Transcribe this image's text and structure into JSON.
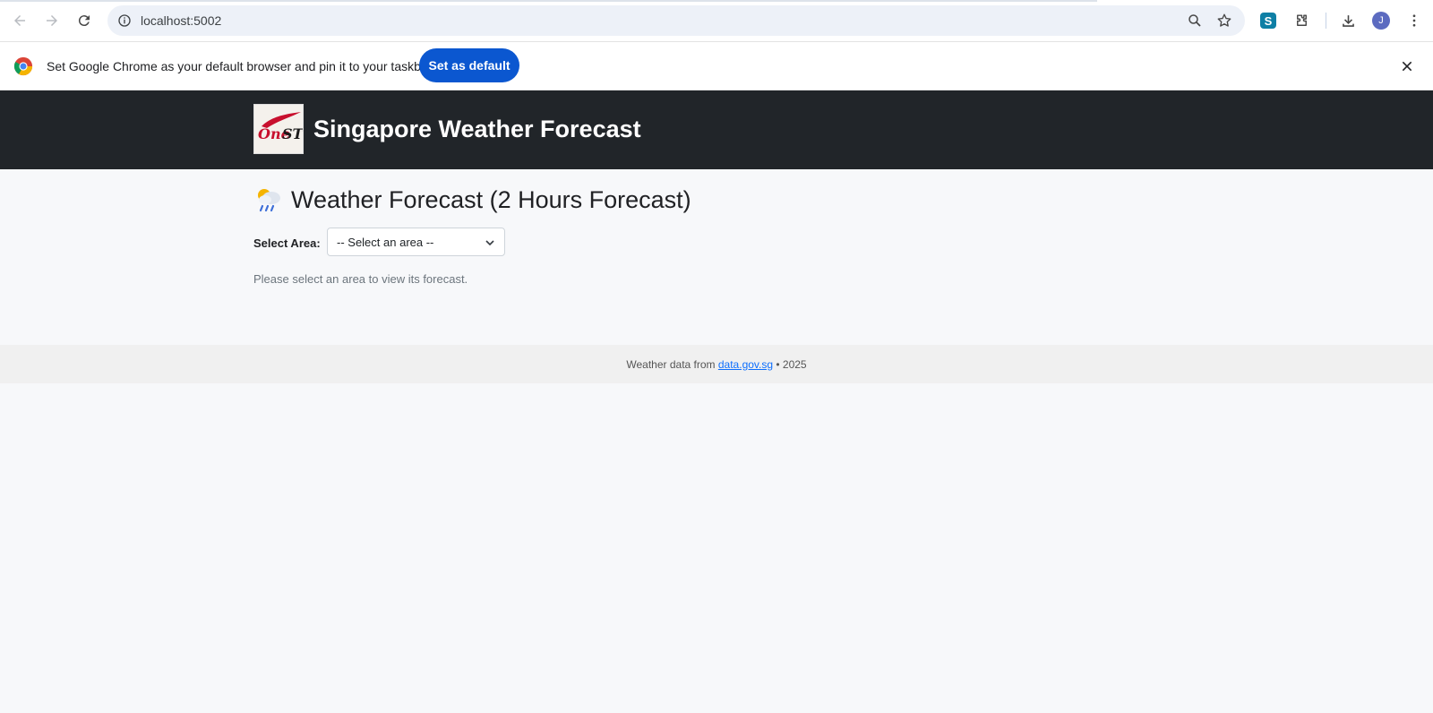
{
  "browser": {
    "url": "localhost:5002",
    "avatar_initial": "J",
    "extension_label": "S"
  },
  "infobar": {
    "message": "Set Google Chrome as your default browser and pin it to your taskbar",
    "button_label": "Set as default"
  },
  "header": {
    "logo_text": "OneST",
    "title": "Singapore Weather Forecast"
  },
  "main": {
    "heading": "Weather Forecast (2 Hours Forecast)",
    "heading_icon": "sun-behind-rain-cloud-icon",
    "select_label": "Select Area:",
    "select_value": "-- Select an area --",
    "hint": "Please select an area to view its forecast."
  },
  "footer": {
    "prefix": "Weather data from ",
    "link_text": "data.gov.sg",
    "suffix": " • 2025"
  },
  "colors": {
    "header_bg": "#212529",
    "accent_button": "#0b57d0",
    "link": "#0d6efd"
  }
}
